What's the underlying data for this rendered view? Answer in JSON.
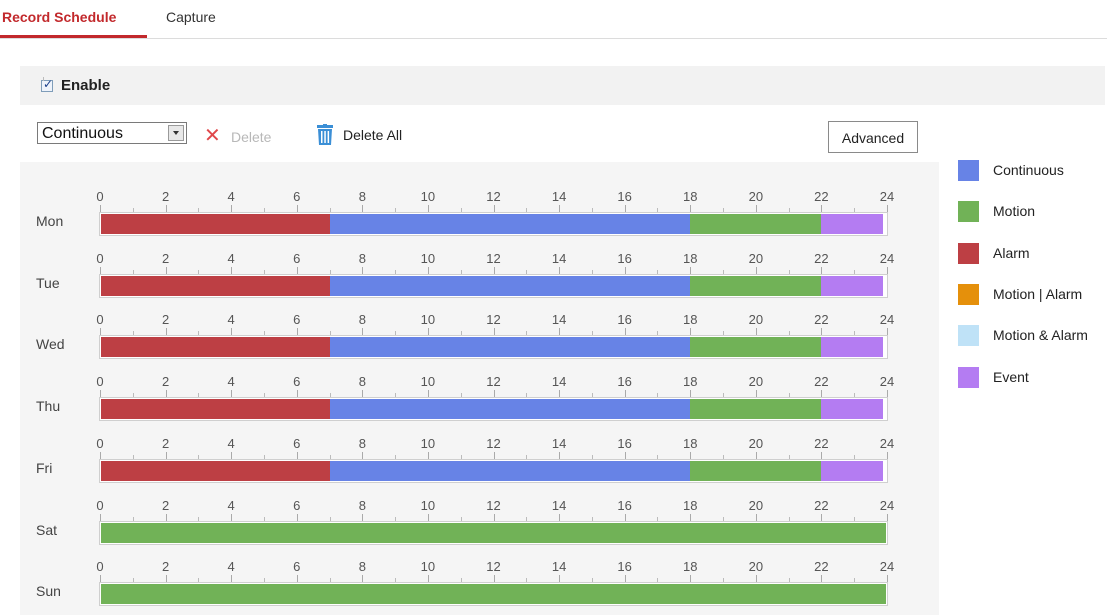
{
  "tabs": [
    {
      "label": "Record Schedule",
      "active": true
    },
    {
      "label": "Capture",
      "active": false
    }
  ],
  "enable": {
    "label": "Enable",
    "checked": true
  },
  "toolbar": {
    "select_value": "Continuous",
    "delete_label": "Delete",
    "delete_all_label": "Delete All",
    "advanced_label": "Advanced"
  },
  "schedule": {
    "hours": [
      "0",
      "2",
      "4",
      "6",
      "8",
      "10",
      "12",
      "14",
      "16",
      "18",
      "20",
      "22",
      "24"
    ],
    "days": [
      {
        "label": "Mon",
        "segments": [
          {
            "type": "Alarm",
            "start": 0,
            "end": 7
          },
          {
            "type": "Continuous",
            "start": 7,
            "end": 18
          },
          {
            "type": "Motion",
            "start": 18,
            "end": 22
          },
          {
            "type": "Event",
            "start": 22,
            "end": 23.9
          }
        ]
      },
      {
        "label": "Tue",
        "segments": [
          {
            "type": "Alarm",
            "start": 0,
            "end": 7
          },
          {
            "type": "Continuous",
            "start": 7,
            "end": 18
          },
          {
            "type": "Motion",
            "start": 18,
            "end": 22
          },
          {
            "type": "Event",
            "start": 22,
            "end": 23.9
          }
        ]
      },
      {
        "label": "Wed",
        "segments": [
          {
            "type": "Alarm",
            "start": 0,
            "end": 7
          },
          {
            "type": "Continuous",
            "start": 7,
            "end": 18
          },
          {
            "type": "Motion",
            "start": 18,
            "end": 22
          },
          {
            "type": "Event",
            "start": 22,
            "end": 23.9
          }
        ]
      },
      {
        "label": "Thu",
        "segments": [
          {
            "type": "Alarm",
            "start": 0,
            "end": 7
          },
          {
            "type": "Continuous",
            "start": 7,
            "end": 18
          },
          {
            "type": "Motion",
            "start": 18,
            "end": 22
          },
          {
            "type": "Event",
            "start": 22,
            "end": 23.9
          }
        ]
      },
      {
        "label": "Fri",
        "segments": [
          {
            "type": "Alarm",
            "start": 0,
            "end": 7
          },
          {
            "type": "Continuous",
            "start": 7,
            "end": 18
          },
          {
            "type": "Motion",
            "start": 18,
            "end": 22
          },
          {
            "type": "Event",
            "start": 22,
            "end": 23.9
          }
        ]
      },
      {
        "label": "Sat",
        "segments": [
          {
            "type": "Motion",
            "start": 0,
            "end": 24
          }
        ]
      },
      {
        "label": "Sun",
        "segments": [
          {
            "type": "Motion",
            "start": 0,
            "end": 24
          }
        ]
      }
    ]
  },
  "legend": [
    {
      "label": "Continuous",
      "color": "#6783e6"
    },
    {
      "label": "Motion",
      "color": "#71b257"
    },
    {
      "label": "Alarm",
      "color": "#bd3f44"
    },
    {
      "label": "Motion | Alarm",
      "color": "#e5900b"
    },
    {
      "label": "Motion & Alarm",
      "color": "#bfe2f7"
    },
    {
      "label": "Event",
      "color": "#b47cf2"
    }
  ]
}
